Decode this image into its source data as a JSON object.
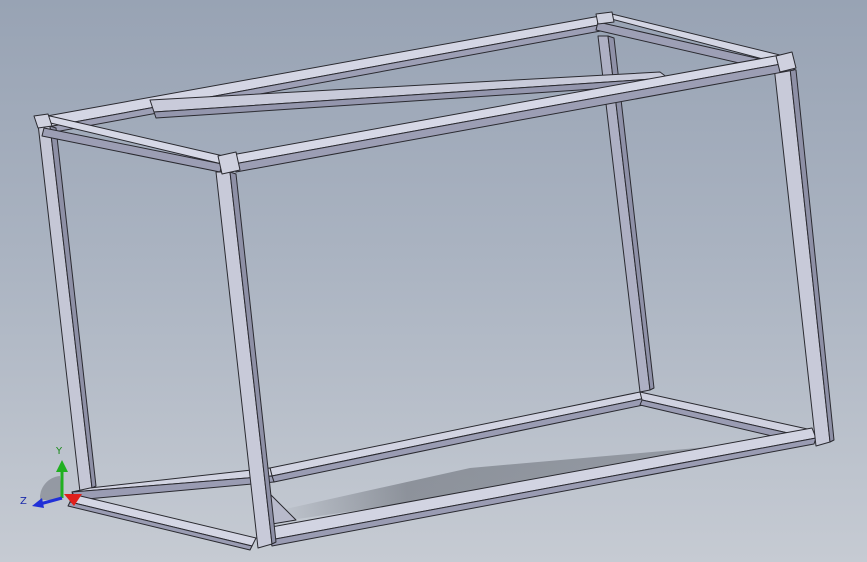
{
  "viewport": {
    "background_top": "#98a3b4",
    "background_bottom": "#c6cbd3",
    "model": "rectangular-tube-frame"
  },
  "triad": {
    "x_label": "",
    "y_label": "Y",
    "z_label": "Z",
    "x_color": "#e0201c",
    "y_color": "#20b020",
    "z_color": "#2030d8"
  },
  "colors": {
    "tube_top": "#d4d6e4",
    "tube_side": "#9d9fb5",
    "edge": "#2a2a30"
  }
}
